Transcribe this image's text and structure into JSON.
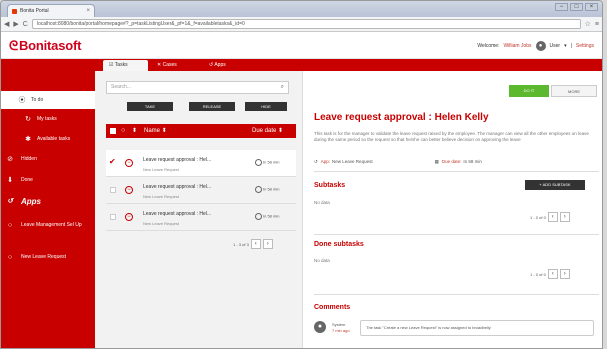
{
  "browser": {
    "tab_title": "Bonita Portal",
    "url": "localhost:8080/bonita/portal/homepage#?_p=taskListingUser&_pf=1&_f=availabletasks&_id=0",
    "close_glyph": "×",
    "nav_back": "◀",
    "nav_forward": "▶",
    "nav_reload": "C",
    "star_icon": "☆",
    "menu_icon": "≡"
  },
  "header": {
    "logo": "Bonitasoft",
    "welcome": "Welcome:",
    "user_name": "William Jobs",
    "user_menu": "User",
    "settings": "Settings"
  },
  "tabs": [
    {
      "label": "Tasks",
      "icon": "tasks-icon",
      "glyph": "☑"
    },
    {
      "label": "Cases",
      "icon": "cases-icon",
      "glyph": "✕"
    },
    {
      "label": "Apps",
      "icon": "apps-icon",
      "glyph": "↺"
    }
  ],
  "sidebar": {
    "items": [
      {
        "label": "To do",
        "glyph": "⦿"
      },
      {
        "label": "My tasks",
        "glyph": "↻"
      },
      {
        "label": "Available tasks",
        "glyph": "✱"
      },
      {
        "label": "Hidden",
        "glyph": "⊘"
      },
      {
        "label": "Done",
        "glyph": "⬇"
      },
      {
        "label": "Apps",
        "glyph": "↺"
      },
      {
        "label": "Leave Management Sel Up",
        "glyph": "○"
      },
      {
        "label": "New Leave Request",
        "glyph": "○"
      }
    ]
  },
  "list": {
    "search_placeholder": "Search...",
    "search_icon": "⌕",
    "buttons": {
      "take": "TAKE",
      "release": "RELEASE",
      "hide": "HIDE"
    },
    "columns": {
      "name": "Name",
      "due": "Due date"
    },
    "sort_glyph": "⬍",
    "rows": [
      {
        "title": "Leave request approval : Hel...",
        "sub": "New Leave Request",
        "due": "In 58 min"
      },
      {
        "title": "Leave request approval : Hel...",
        "sub": "New Leave Request",
        "due": "In 58 min"
      },
      {
        "title": "Leave request approval : Hel...",
        "sub": "New Leave Request",
        "due": "In 58 min"
      }
    ],
    "pager": "1 - 3 of 3",
    "prev": "‹",
    "next": "›",
    "check_glyph": "✔",
    "priority_glyph": "−",
    "chevron": "›"
  },
  "detail": {
    "do_it": "DO IT",
    "more": "MORE",
    "title": "Leave request approval : Helen Kelly",
    "description": "This task is for the manager to validate the leave request raised by the employee. The manager can view all the other employees on leave during the same period so the request so that he/she can better believe decision on approving the leave",
    "app_label": "App:",
    "app_value": "New Leave Request",
    "due_label": "Due date:",
    "due_value": "In 58 min",
    "subtasks": "Subtasks",
    "add_subtask": "+ ADD SUBTASK",
    "no_data": "No data",
    "done_subtasks": "Done subtasks",
    "comments": "Comments",
    "comment_user": "System",
    "comment_time": "7 min ago",
    "comment_text": "The task \"Create a new Leave Request\" is now assigned to broadbelly",
    "pager": "1 - 0 of 0",
    "app_glyph": "↺",
    "cal_glyph": "▦",
    "avatar_glyph": "●"
  },
  "colors": {
    "brand_red": "#c80000",
    "do_it_green": "#5cb82f"
  }
}
